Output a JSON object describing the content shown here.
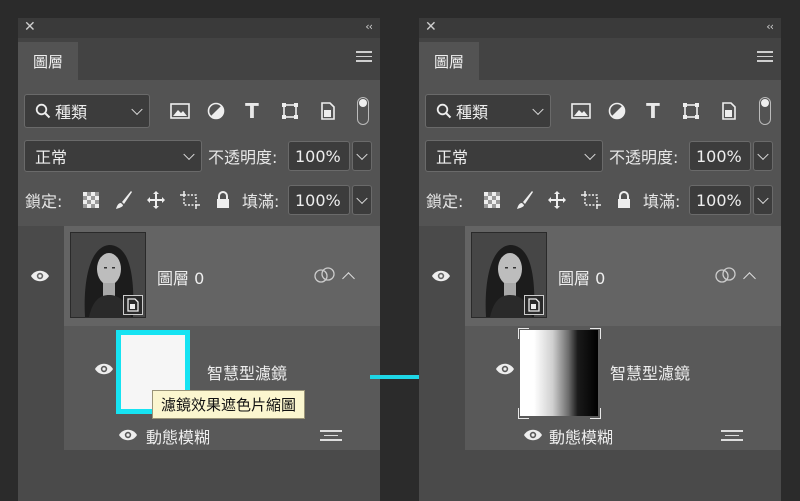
{
  "panel_tab": "圖層",
  "filter_kind": "種類",
  "blend_mode": "正常",
  "opacity_label": "不透明度:",
  "opacity_value": "100%",
  "lock_label": "鎖定:",
  "fill_label": "填滿:",
  "fill_value": "100%",
  "layer_name": "圖層 0",
  "smart_filters_label": "智慧型濾鏡",
  "filter_name": "動態模糊",
  "tooltip": "濾鏡效果遮色片縮圖",
  "colors": {
    "highlight": "#16e3f2",
    "arrow": "#1ed6e6"
  }
}
